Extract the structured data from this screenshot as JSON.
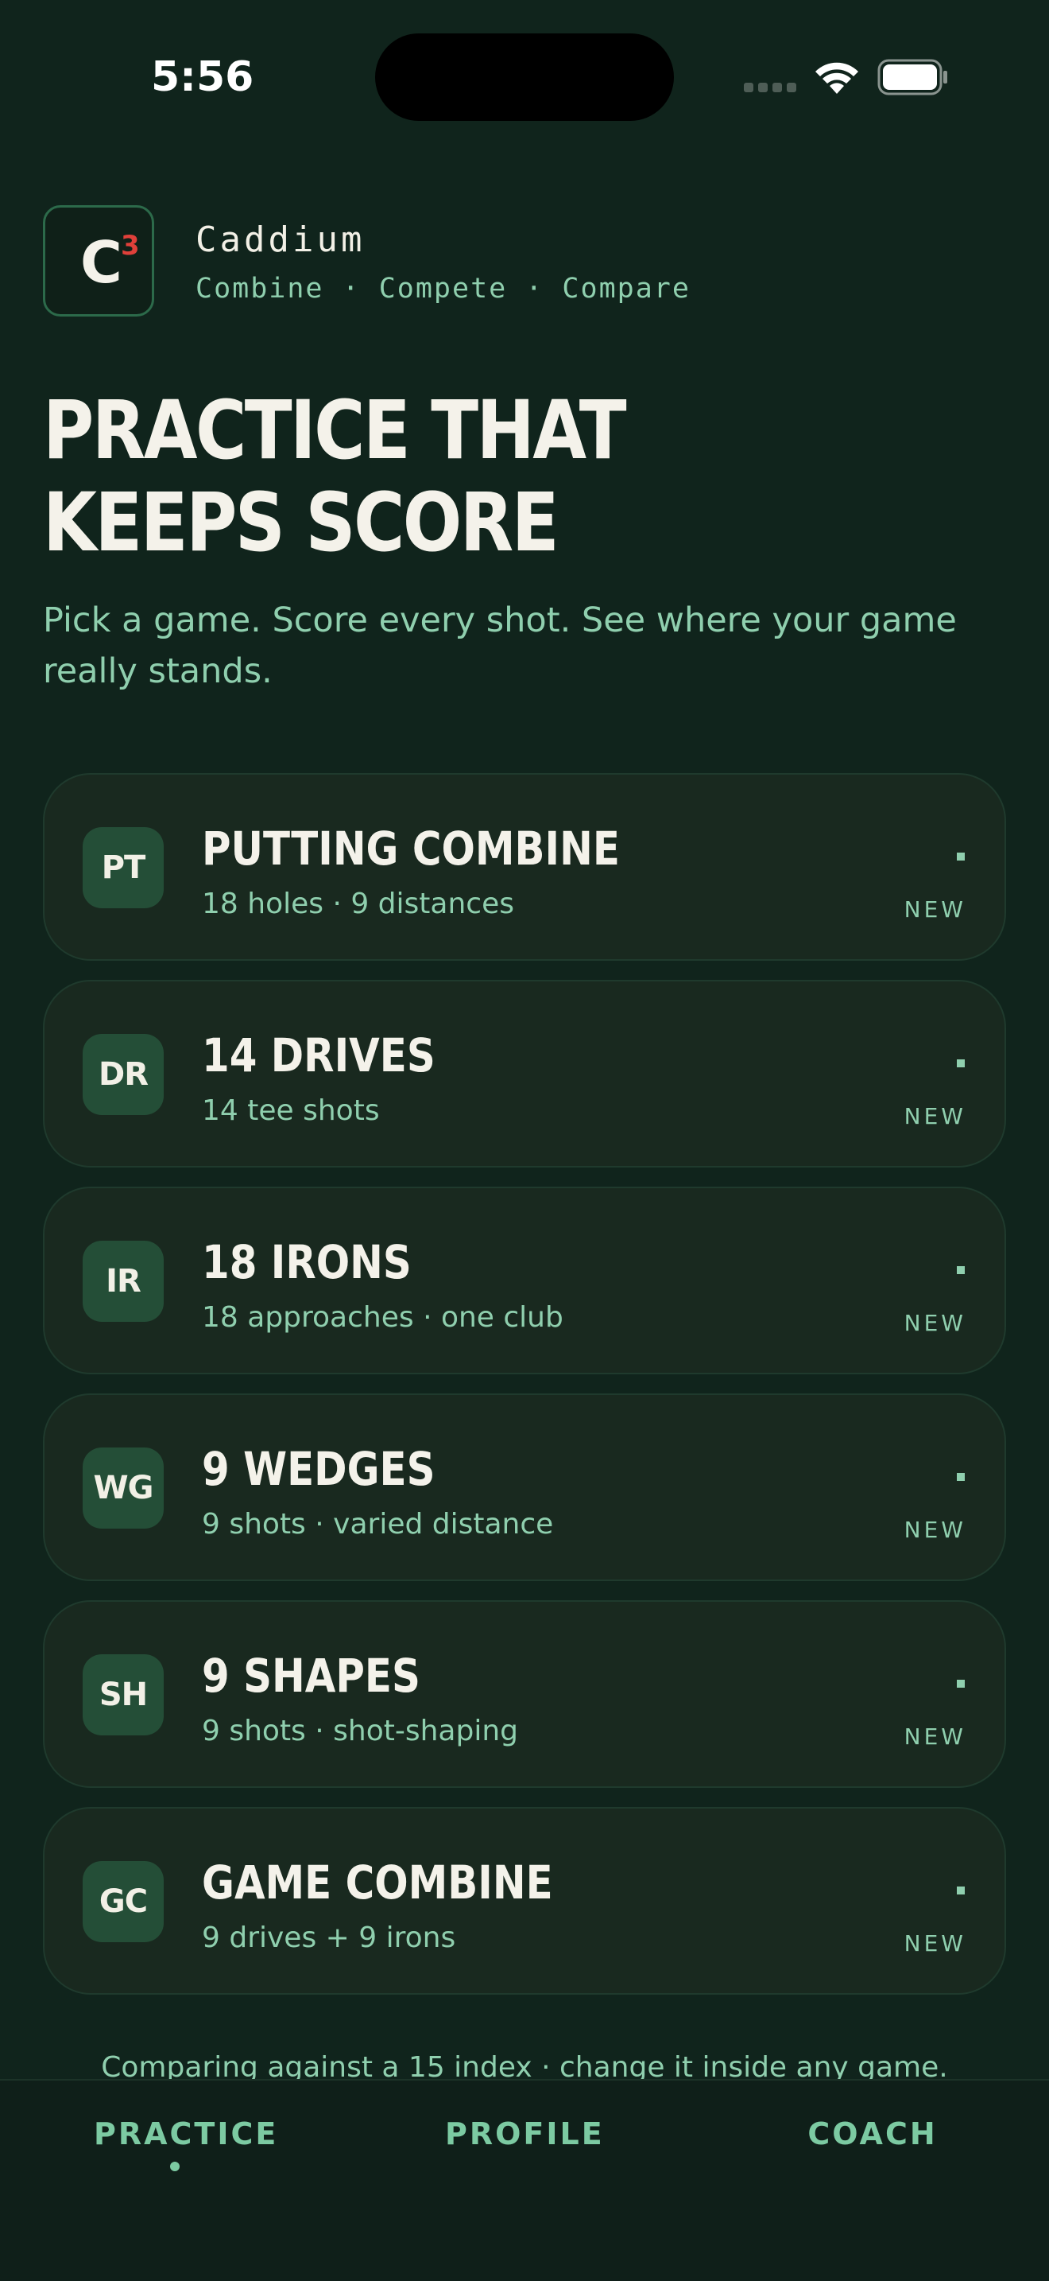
{
  "status_bar": {
    "time": "5:56"
  },
  "brand": {
    "logo_letter": "C",
    "logo_superscript": "3",
    "name": "Caddium",
    "tagline": "Combine · Compete · Compare"
  },
  "hero": {
    "title_line1": "PRACTICE THAT",
    "title_line2": "KEEPS SCORE",
    "subtitle": "Pick a game. Score every shot. See where your game really stands."
  },
  "games": [
    {
      "badge": "PT",
      "title": "PUTTING COMBINE",
      "subtitle": "18 holes · 9 distances",
      "tag": "NEW"
    },
    {
      "badge": "DR",
      "title": "14 DRIVES",
      "subtitle": "14 tee shots",
      "tag": "NEW"
    },
    {
      "badge": "IR",
      "title": "18 IRONS",
      "subtitle": "18 approaches · one club",
      "tag": "NEW"
    },
    {
      "badge": "WG",
      "title": "9 WEDGES",
      "subtitle": "9 shots · varied distance",
      "tag": "NEW"
    },
    {
      "badge": "SH",
      "title": "9 SHAPES",
      "subtitle": "9 shots · shot-shaping",
      "tag": "NEW"
    },
    {
      "badge": "GC",
      "title": "GAME COMBINE",
      "subtitle": "9 drives + 9 irons",
      "tag": "NEW"
    }
  ],
  "footer": {
    "note": "Comparing against a 15 index · change it inside any game."
  },
  "tabbar": {
    "tabs": [
      {
        "label": "PRACTICE",
        "active": true
      },
      {
        "label": "PROFILE",
        "active": false
      },
      {
        "label": "COACH",
        "active": false
      }
    ]
  },
  "colors": {
    "background": "#10241c",
    "card": "#19291f",
    "accent": "#8fcfae",
    "badge": "#244e37",
    "logo_superscript": "#e0403a",
    "text_primary": "#f4f2ea"
  },
  "icons": {
    "signal": "cellular-signal-icon",
    "wifi": "wifi-icon",
    "battery": "battery-icon"
  }
}
